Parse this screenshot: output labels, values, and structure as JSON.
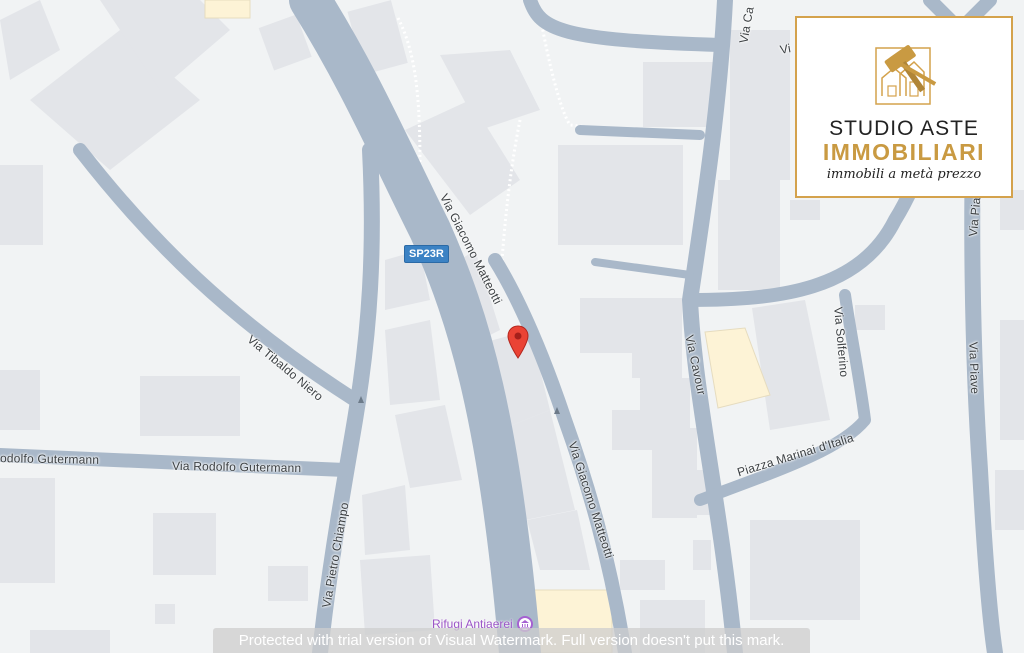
{
  "map": {
    "route_badge": "SP23R",
    "streets": {
      "via_cavour_top": "Via Ca",
      "via_top_right": "Vi",
      "via_piave_top": "Via Pia",
      "via_giacomo_matteotti_upper": "Via Giacomo Matteotti",
      "via_giacomo_matteotti_lower": "Via Giacomo Matteotti",
      "via_tibaldo_niero": "Via Tibaldo Niero",
      "via_solferino": "Via Solferino",
      "via_cavour": "Via Cavour",
      "via_piave": "Via Piave",
      "via_rodolfo_gutermann_left": "odolfo Gutermann",
      "via_rodolfo_gutermann": "Via Rodolfo Gutermann",
      "piazza_marinai_italia": "Piazza Marinai d'Italia",
      "via_pietro_chiampo": "Via Pietro Chiampo"
    },
    "poi": {
      "label": "Rifugi Antiaerei",
      "icon": "museum-icon"
    },
    "marker": {
      "icon": "location-pin-icon",
      "color": "#ea4335"
    }
  },
  "logo": {
    "icon": "gavel-house-icon",
    "line1": "STUDIO ASTE",
    "line2": "IMMOBILIARI",
    "line3": "immobili a metà prezzo",
    "accent_color": "#c99a42"
  },
  "watermark": "Protected with trial version of Visual Watermark. Full version doesn't put this mark.",
  "colors": {
    "background": "#f1f3f4",
    "road": "#aab9ca",
    "building": "#e4e6ea",
    "highlight_building": "#fdf3d8"
  }
}
